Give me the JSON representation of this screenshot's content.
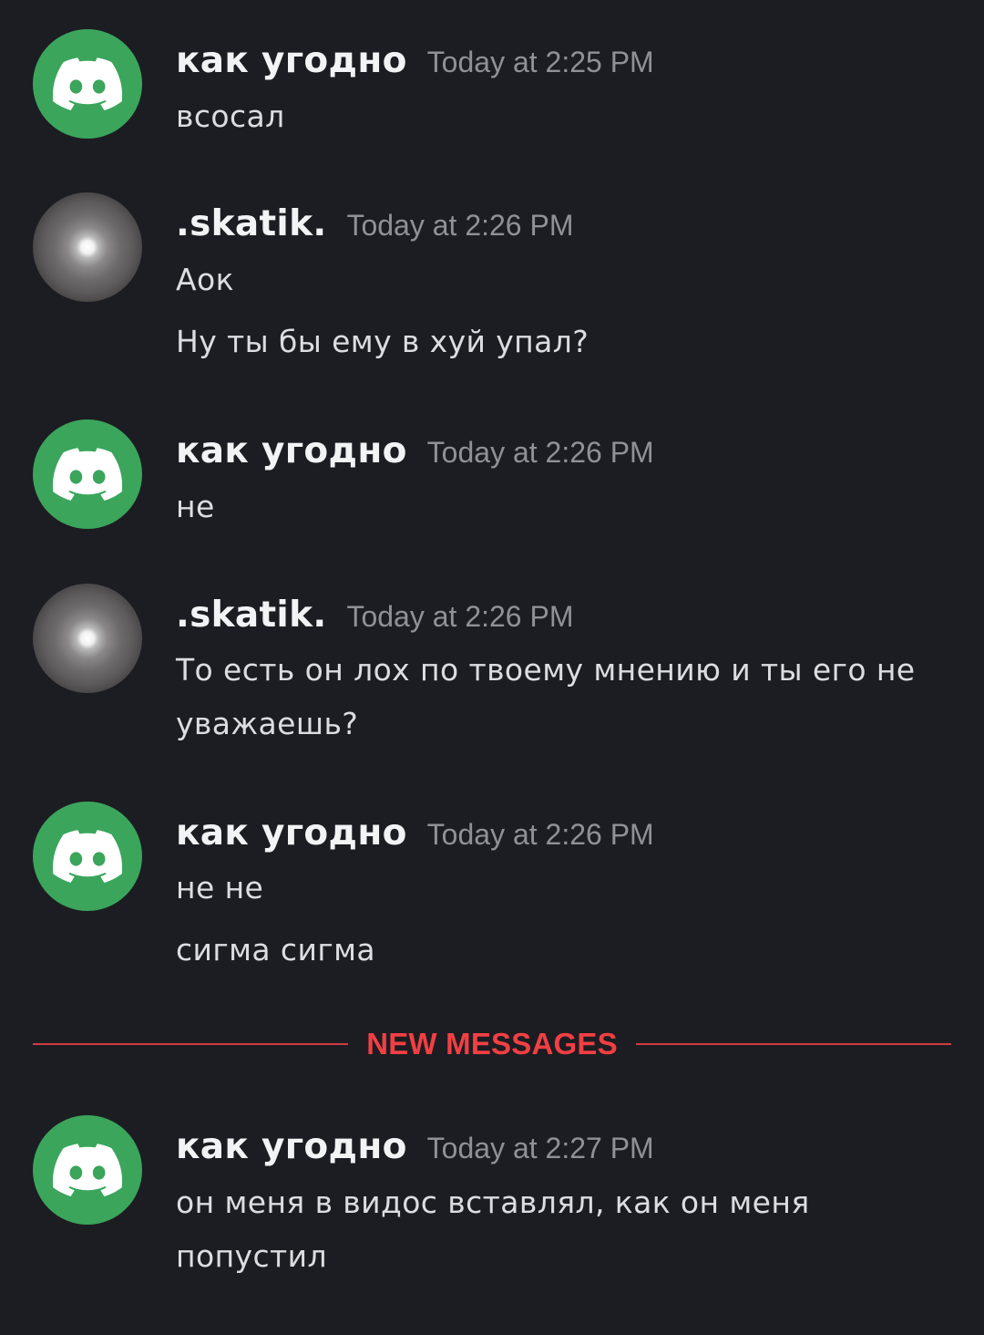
{
  "messages": [
    {
      "author": "как угодно",
      "timestamp": "Today at 2:25 PM",
      "avatar": "discord-logo-icon",
      "lines": [
        "всосал"
      ]
    },
    {
      "author": ".skatik.",
      "timestamp": "Today at 2:26 PM",
      "avatar": "moon-photo",
      "lines": [
        "Аок",
        "Ну ты бы ему в хуй упал?"
      ]
    },
    {
      "author": "как угодно",
      "timestamp": "Today at 2:26 PM",
      "avatar": "discord-logo-icon",
      "lines": [
        "не"
      ]
    },
    {
      "author": ".skatik.",
      "timestamp": "Today at 2:26 PM",
      "avatar": "moon-photo",
      "lines": [
        "То есть он лох по твоему мнению и ты его не",
        "уважаешь?"
      ]
    },
    {
      "author": "как угодно",
      "timestamp": "Today at 2:26 PM",
      "avatar": "discord-logo-icon",
      "lines": [
        "не не",
        "сигма сигма"
      ]
    },
    {
      "author": "как угодно",
      "timestamp": "Today at 2:27 PM",
      "avatar": "discord-logo-icon",
      "lines": [
        "он меня в видос вставлял, как он меня",
        "попустил"
      ]
    }
  ],
  "new_messages_divider": {
    "label": "NEW MESSAGES",
    "color": "#f23f43"
  },
  "colors": {
    "background": "#1c1d22",
    "discord_avatar": "#3ba55c",
    "username": "#f2f3f5",
    "timestamp": "#8e9297",
    "text": "#dbdee1"
  }
}
